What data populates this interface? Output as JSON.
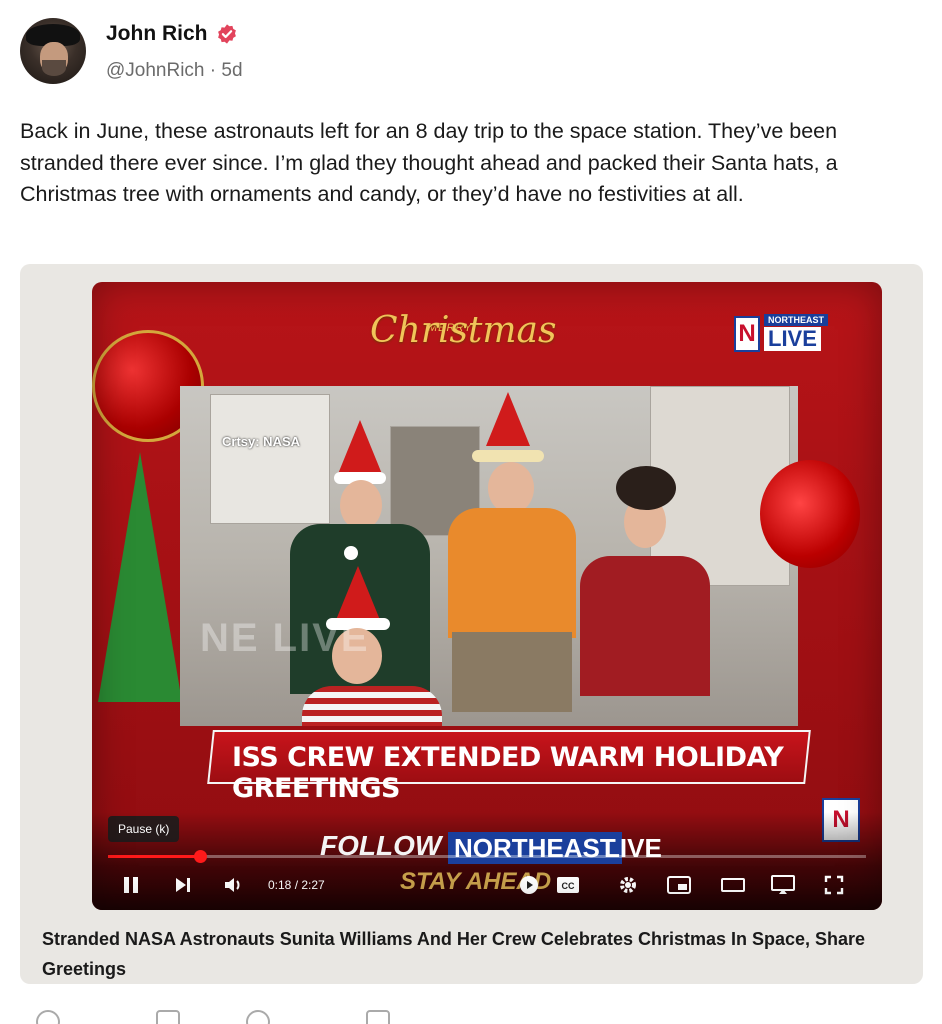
{
  "author": {
    "name": "John Rich",
    "handle": "@JohnRich",
    "separator": "·",
    "age": "5d"
  },
  "post": {
    "text": "Back in June, these astronauts left for an 8 day trip to the space station. They’ve been stranded there ever since. I’m glad they thought ahead and packed their Santa hats, a Christmas tree with ornaments and candy, or they’d have no festivities at all."
  },
  "video": {
    "overlay": {
      "merry": "MERRY",
      "christmas": "Christmas",
      "courtesy": "Crtsy: NASA",
      "logo_north": "NORTHEAST",
      "logo_live": "LIVE",
      "logo_letter": "N",
      "banner": "ISS CREW EXTENDED WARM HOLIDAY GREETINGS",
      "follow": "FOLLOW",
      "follow_ne": "NORTHEAST",
      "follow_live": "LIVE",
      "stay": "STAY AHEAD"
    },
    "player": {
      "tooltip": "Pause (k)",
      "time": "0:18 / 2:27",
      "progress_fraction": 0.122,
      "icons": [
        "pause-icon",
        "next-icon",
        "volume-icon",
        "autoplay-icon",
        "captions-icon",
        "settings-icon",
        "miniplayer-icon",
        "theater-icon",
        "cast-icon",
        "fullscreen-icon"
      ],
      "accent": "#ff1a1a"
    }
  },
  "card": {
    "caption": "Stranded NASA Astronauts Sunita Williams And Her Crew Celebrates Christmas In Space, Share Greetings"
  },
  "colors": {
    "verified": "#e2445c",
    "frame_red": "#b81418",
    "gold": "#f1c55a"
  }
}
